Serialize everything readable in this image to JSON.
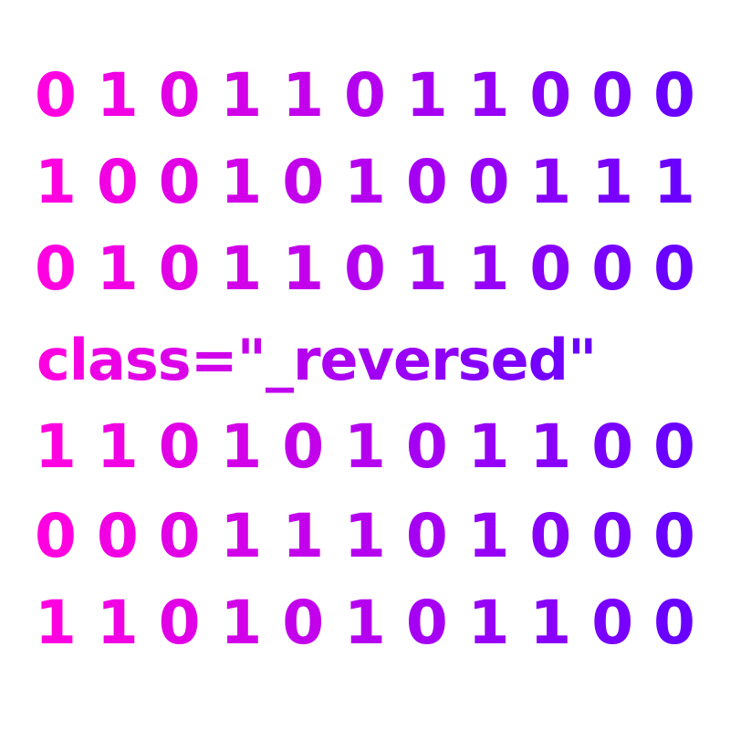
{
  "rows": [
    "0 1 0 1 1 0 1 1 0 0 0",
    "1 0 0 1 0 1 0 0 1 1 1",
    "0 1 0 1 1 0 1 1 0 0 0",
    "class=\"_reversed\"",
    "1 1 0 1 0 1 0 1 1 0 0",
    "0 0 0 1 1 1 0 1 0 0 0",
    "1 1 0 1 0 1 0 1 1 0 0"
  ],
  "colors": {
    "gradient_start": "#ff00e0",
    "gradient_end": "#6a00ff"
  }
}
